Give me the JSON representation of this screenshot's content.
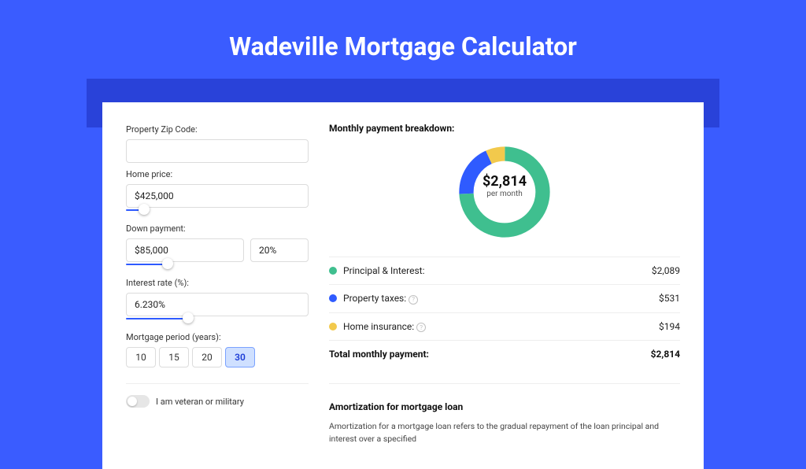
{
  "title": "Wadeville Mortgage Calculator",
  "form": {
    "zip_label": "Property Zip Code:",
    "zip_value": "",
    "home_price_label": "Home price:",
    "home_price_value": "$425,000",
    "down_label": "Down payment:",
    "down_value": "$85,000",
    "down_pct": "20%",
    "rate_label": "Interest rate (%):",
    "rate_value": "6.230%",
    "period_label": "Mortgage period (years):",
    "periods": [
      "10",
      "15",
      "20",
      "30"
    ],
    "period_active": "30",
    "veteran_label": "I am veteran or military"
  },
  "breakdown": {
    "title": "Monthly payment breakdown:",
    "center_amount": "$2,814",
    "center_sub": "per month",
    "items": [
      {
        "name": "Principal & Interest:",
        "value": "$2,089",
        "color": "#3FBF8F"
      },
      {
        "name": "Property taxes:",
        "value": "$531",
        "color": "#2F5BFF",
        "info": true
      },
      {
        "name": "Home insurance:",
        "value": "$194",
        "color": "#F2C94C",
        "info": true
      }
    ],
    "total_label": "Total monthly payment:",
    "total_value": "$2,814"
  },
  "amort": {
    "title": "Amortization for mortgage loan",
    "body": "Amortization for a mortgage loan refers to the gradual repayment of the loan principal and interest over a specified"
  },
  "chart_data": {
    "type": "pie",
    "title": "Monthly payment breakdown",
    "series": [
      {
        "name": "Principal & Interest",
        "value": 2089,
        "color": "#3FBF8F"
      },
      {
        "name": "Property taxes",
        "value": 531,
        "color": "#2F5BFF"
      },
      {
        "name": "Home insurance",
        "value": 194,
        "color": "#F2C94C"
      }
    ],
    "total": 2814
  }
}
